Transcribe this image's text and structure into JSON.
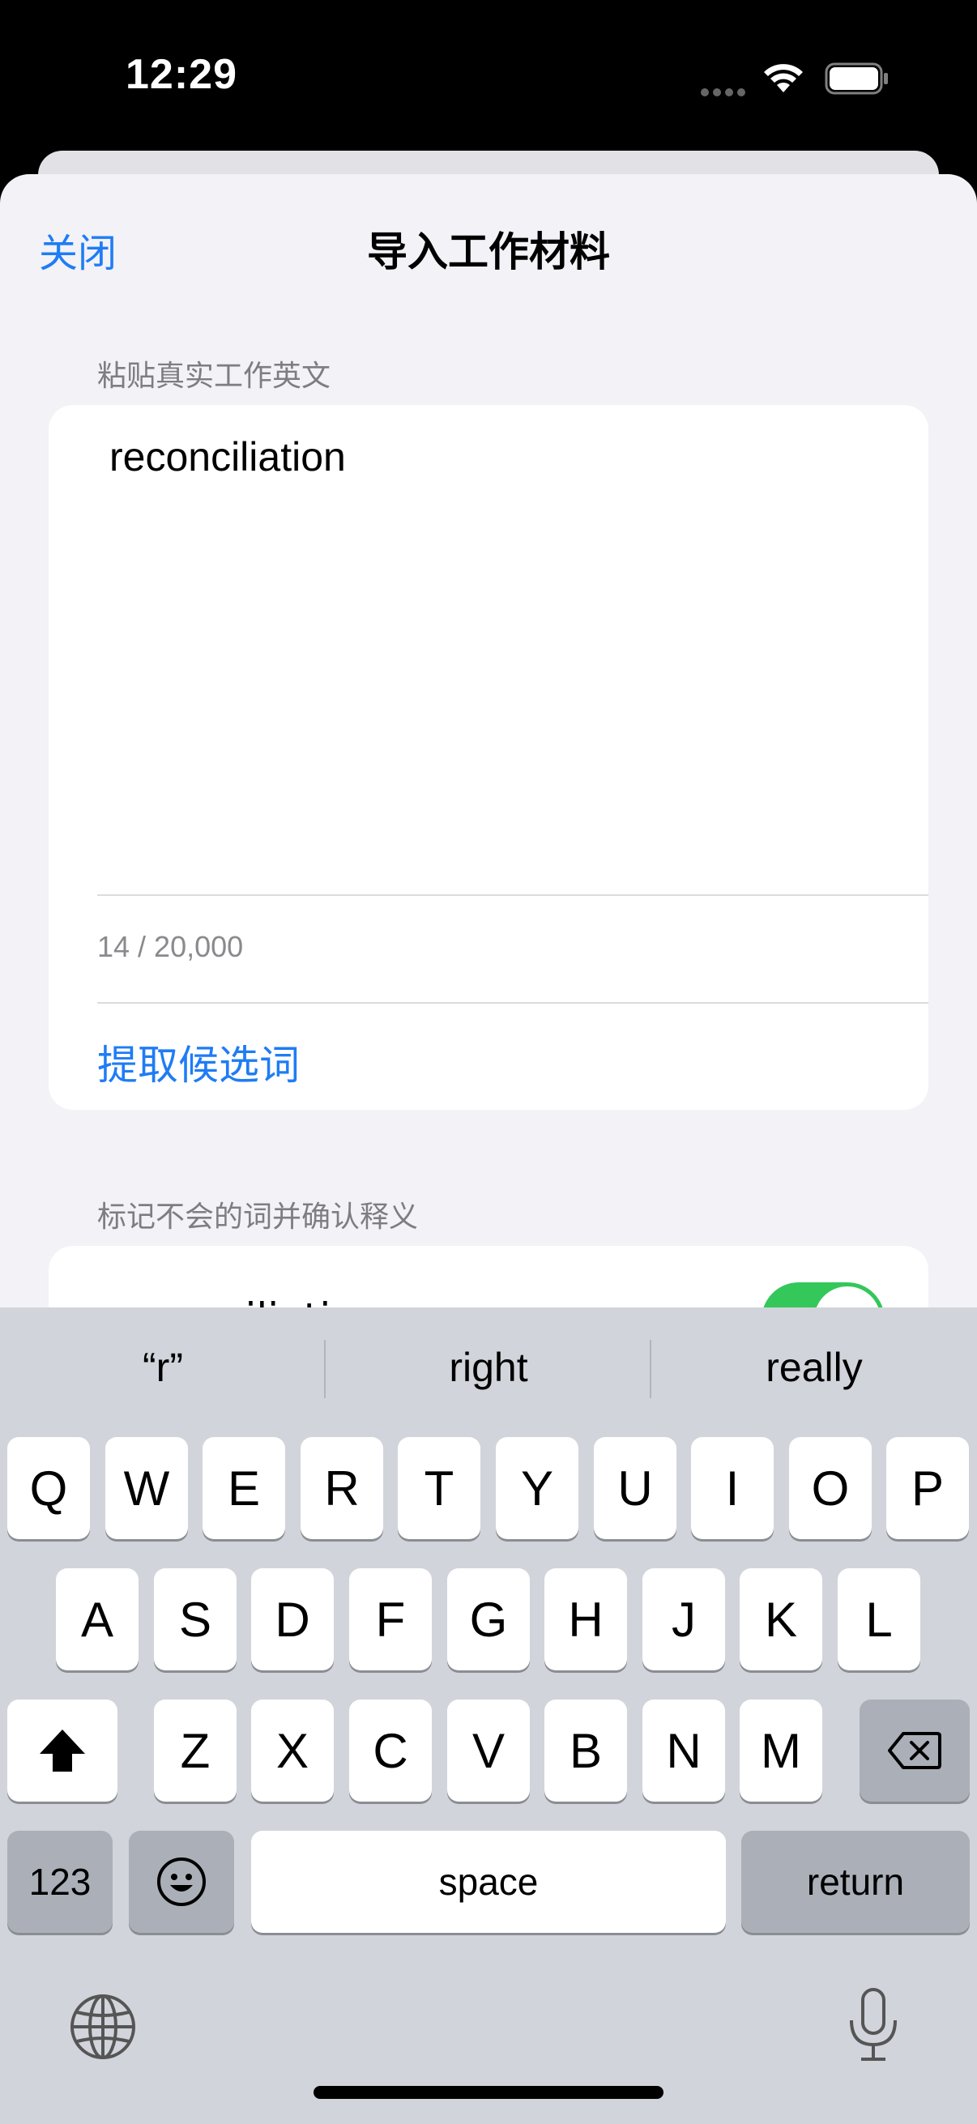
{
  "status": {
    "time": "12:29"
  },
  "nav": {
    "close_label": "关闭",
    "title": "导入工作材料"
  },
  "paste_section": {
    "header": "粘贴真实工作英文",
    "text": "reconciliation",
    "char_count": "14 / 20,000",
    "extract_label": "提取候选词"
  },
  "mark_section": {
    "header": "标记不会的词并确认释义",
    "first_row_word": "reconciliation",
    "first_row_toggle_on": true
  },
  "keyboard": {
    "suggestions": [
      "“r”",
      "right",
      "really"
    ],
    "row1": [
      "Q",
      "W",
      "E",
      "R",
      "T",
      "Y",
      "U",
      "I",
      "O",
      "P"
    ],
    "row2": [
      "A",
      "S",
      "D",
      "F",
      "G",
      "H",
      "J",
      "K",
      "L"
    ],
    "row3": [
      "Z",
      "X",
      "C",
      "V",
      "B",
      "N",
      "M"
    ],
    "numbers_label": "123",
    "space_label": "space",
    "return_label": "return"
  },
  "colors": {
    "accent": "#1f7cf5",
    "toggle_on": "#34c759",
    "sheet_bg": "#f2f2f7"
  },
  "icons": [
    "wifi-icon",
    "battery-icon",
    "shift-icon",
    "delete-icon",
    "emoji-icon",
    "globe-icon",
    "mic-icon"
  ]
}
